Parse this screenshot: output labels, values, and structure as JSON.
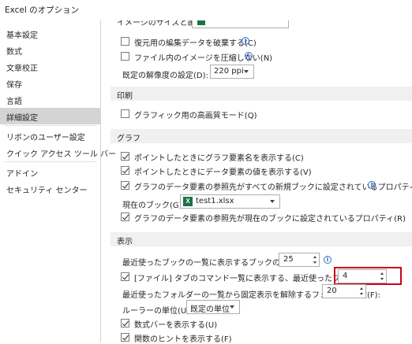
{
  "window": {
    "title": "Excel のオプション"
  },
  "sidebar": {
    "items": [
      {
        "label": "基本設定",
        "selected": false
      },
      {
        "label": "数式",
        "selected": false
      },
      {
        "label": "文章校正",
        "selected": false
      },
      {
        "label": "保存",
        "selected": false
      },
      {
        "label": "言語",
        "selected": false
      },
      {
        "label": "詳細設定",
        "selected": true
      },
      {
        "label": "リボンのユーザー設定",
        "selected": false
      },
      {
        "label": "クイック アクセス ツール バー",
        "selected": false
      },
      {
        "label": "アドイン",
        "selected": false
      },
      {
        "label": "セキュリティ センター",
        "selected": false
      }
    ]
  },
  "image_size": {
    "partial_label": "イメージのサイズと画質",
    "discard_edit_data": {
      "label": "復元用の編集データを破棄する(C)",
      "checked": false
    },
    "no_compress": {
      "label": "ファイル内のイメージを圧縮しない(N)",
      "checked": false
    },
    "resolution": {
      "label": "既定の解像度の設定(D):",
      "value": "220 ppi"
    }
  },
  "print": {
    "title": "印刷",
    "high_quality_graphics": {
      "label": "グラフィック用の高画質モード(Q)",
      "checked": false
    }
  },
  "chart": {
    "title": "グラフ",
    "show_element_names": {
      "label": "ポイントしたときにグラフ要素名を表示する(C)",
      "checked": true
    },
    "show_data_values": {
      "label": "ポイントしたときにデータ要素の値を表示する(V)",
      "checked": true
    },
    "properties_all_new": {
      "label": "グラフのデータ要素の参照先がすべての新規ブックに設定されているプロパティ(P)",
      "checked": true
    },
    "current_book": {
      "label": "現在のブック(G):",
      "value": "test1.xlsx",
      "icon": "excel-file-icon"
    },
    "properties_current": {
      "label": "グラフのデータ要素の参照先が現在のブックに設定されているプロパティ(R)",
      "checked": true
    }
  },
  "display": {
    "title": "表示",
    "recent_books": {
      "label": "最近使ったブックの一覧に表示するブックの数(R):",
      "value": "25"
    },
    "quick_access_recent": {
      "label": "[ファイル] タブのコマンド一覧に表示する、最近使ったブックの数(Q):",
      "checked": true,
      "value": "4"
    },
    "recent_folders": {
      "label": "最近使ったフォルダーの一覧から固定表示を解除するフォルダーの数(F):",
      "value": "20"
    },
    "ruler_units": {
      "label": "ルーラーの単位(U)",
      "value": "既定の単位"
    },
    "show_formula_bar": {
      "label": "数式バーを表示する(U)",
      "checked": true
    },
    "show_function_tips": {
      "label": "関数のヒントを表示する(F)",
      "checked": true
    }
  },
  "colors": {
    "highlight": "#d0021b",
    "selected_nav": "#d4d4d4",
    "section_bg": "#f0f0f0",
    "excel_green": "#1d7145"
  }
}
